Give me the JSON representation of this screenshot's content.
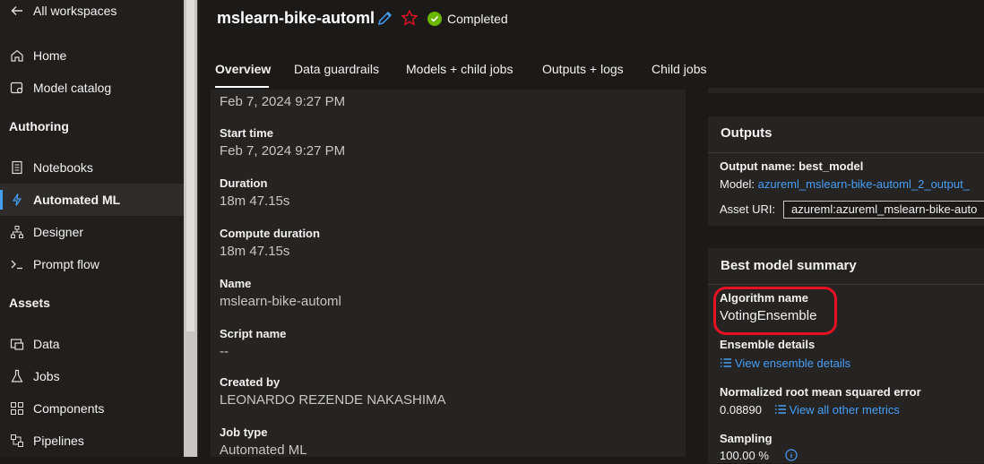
{
  "sidebar": {
    "back_label": "All workspaces",
    "items": [
      {
        "label": "Home",
        "icon": "home-icon"
      },
      {
        "label": "Model catalog",
        "icon": "model-catalog-icon"
      }
    ],
    "authoring_header": "Authoring",
    "authoring_items": [
      {
        "label": "Notebooks",
        "icon": "notebook-icon"
      },
      {
        "label": "Automated ML",
        "icon": "automated-ml-icon",
        "active": true
      },
      {
        "label": "Designer",
        "icon": "designer-icon"
      },
      {
        "label": "Prompt flow",
        "icon": "prompt-flow-icon"
      }
    ],
    "assets_header": "Assets",
    "assets_items": [
      {
        "label": "Data",
        "icon": "data-icon"
      },
      {
        "label": "Jobs",
        "icon": "jobs-icon"
      },
      {
        "label": "Components",
        "icon": "components-icon"
      },
      {
        "label": "Pipelines",
        "icon": "pipelines-icon"
      }
    ]
  },
  "header": {
    "title": "mslearn-bike-automl",
    "status": "Completed"
  },
  "tabs": [
    "Overview",
    "Data guardrails",
    "Models + child jobs",
    "Outputs + logs",
    "Child jobs"
  ],
  "details": {
    "created_on_value": "Feb 7, 2024 9:27 PM",
    "start_time_label": "Start time",
    "start_time_value": "Feb 7, 2024 9:27 PM",
    "duration_label": "Duration",
    "duration_value": "18m 47.15s",
    "compute_duration_label": "Compute duration",
    "compute_duration_value": "18m 47.15s",
    "name_label": "Name",
    "name_value": "mslearn-bike-automl",
    "script_name_label": "Script name",
    "script_name_value": "--",
    "created_by_label": "Created by",
    "created_by_value": "LEONARDO REZENDE NAKASHIMA",
    "job_type_label": "Job type",
    "job_type_value": "Automated ML"
  },
  "outputs": {
    "title": "Outputs",
    "output_name_label": "Output name: best_model",
    "model_label": "Model:",
    "model_value": "azureml_mslearn-bike-automl_2_output_",
    "asset_uri_label": "Asset URI:",
    "asset_uri_value": "azureml:azureml_mslearn-bike-auto"
  },
  "best_model": {
    "title": "Best model summary",
    "algorithm_label": "Algorithm name",
    "algorithm_value": "VotingEnsemble",
    "ensemble_label": "Ensemble details",
    "ensemble_link": "View ensemble details",
    "metric_label": "Normalized root mean squared error",
    "metric_value": "0.08890",
    "metrics_link": "View all other metrics",
    "sampling_label": "Sampling",
    "sampling_value": "100.00 %"
  },
  "colors": {
    "accent": "#479ef5",
    "success": "#6bb700",
    "annotation": "#e81123",
    "favorite": "#e81123"
  }
}
